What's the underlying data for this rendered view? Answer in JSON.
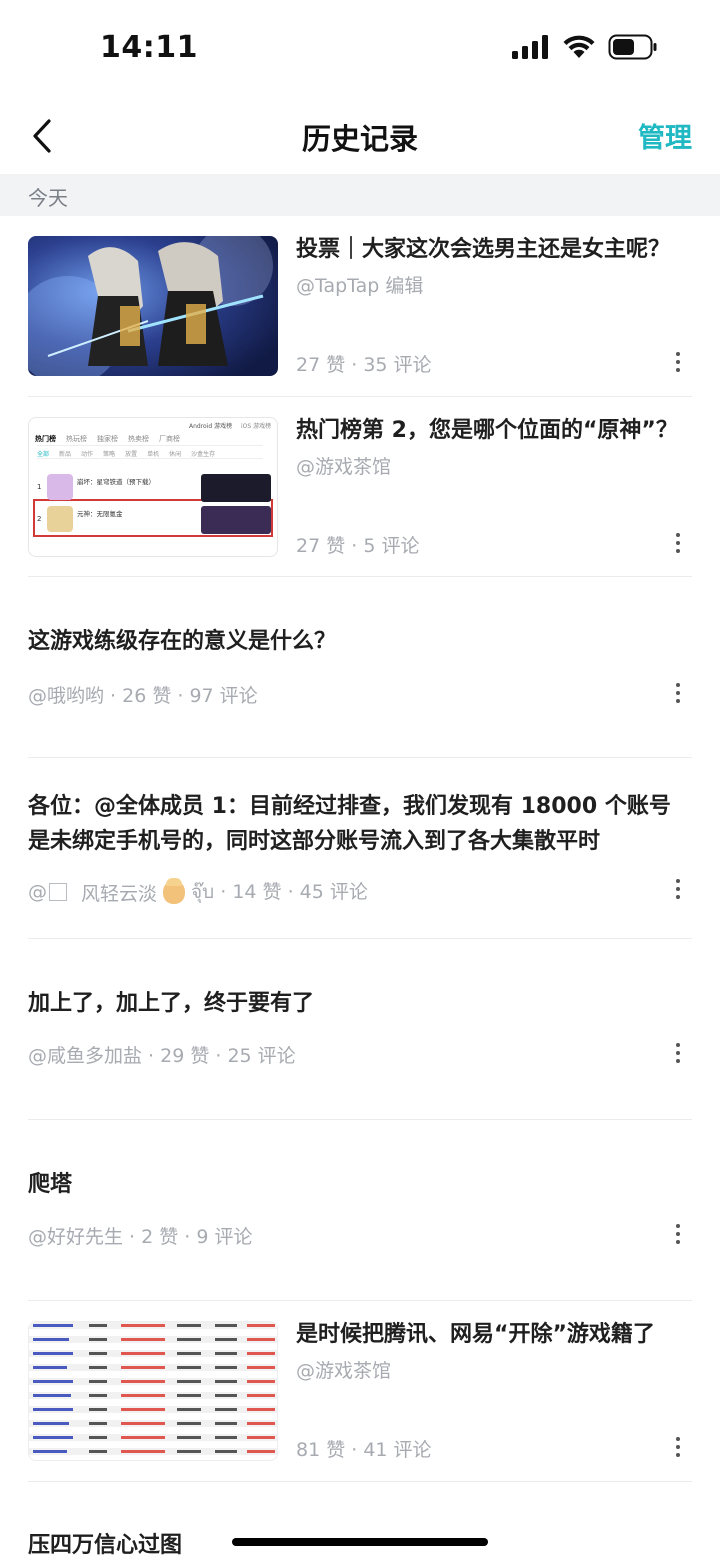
{
  "status": {
    "time": "14:11"
  },
  "nav": {
    "title": "历史记录",
    "manage": "管理"
  },
  "section": {
    "label": "今天"
  },
  "colors": {
    "accent": "#1fb8c3",
    "meta": "#a7abb1",
    "section_bg": "#f2f3f5"
  },
  "icons": [
    "back-arrow-icon",
    "more-dots-icon",
    "signal-icon",
    "wifi-icon",
    "battery-icon"
  ],
  "items": [
    {
      "title": "投票｜大家这次会选男主还是女主呢？",
      "author": "@TapTap 编辑",
      "stats": "27 赞 · 35 评论"
    },
    {
      "title": "热门榜第 2，您是哪个位面的“原神”？",
      "author": "@游戏茶馆",
      "stats": "27 赞 · 5 评论"
    },
    {
      "title": "这游戏练级存在的意义是什么？",
      "meta": "@哦哟哟 · 26 赞 · 97 评论"
    },
    {
      "title": "各位：@全体成员 1：目前经过排查，我们发现有 18000 个账号是未绑定手机号的，同时这部分账号流入到了各大集散平时",
      "meta_prefix": "@",
      "meta_name": "风轻云淡",
      "meta_suffix": "จุ๊บ · 14 赞 · 45 评论"
    },
    {
      "title": "加上了，加上了，终于要有了",
      "meta": "@咸鱼多加盐 · 29 赞 · 25 评论"
    },
    {
      "title": "爬塔",
      "meta": "@好好先生 · 2 赞 · 9 评论"
    },
    {
      "title": "是时候把腾讯、网易“开除”游戏籍了",
      "author": "@游戏茶馆",
      "stats": "81 赞 · 41 评论"
    },
    {
      "title": "压四万信心过图"
    }
  ],
  "thumb_text": {
    "tabs": [
      "Android 游戏榜",
      "iOS 游戏榜"
    ],
    "rank_header": "热门榜",
    "rank_tabs": [
      "热门榜",
      "热玩榜",
      "独家榜",
      "热卖榜",
      "厂商榜"
    ],
    "filters": [
      "全部",
      "新品",
      "动作",
      "策略",
      "放置",
      "单机",
      "休闲",
      "沙盒生存"
    ],
    "rank1": "崩坏：星穹铁道（预下载）",
    "rank2": "元神：无限氪金"
  }
}
